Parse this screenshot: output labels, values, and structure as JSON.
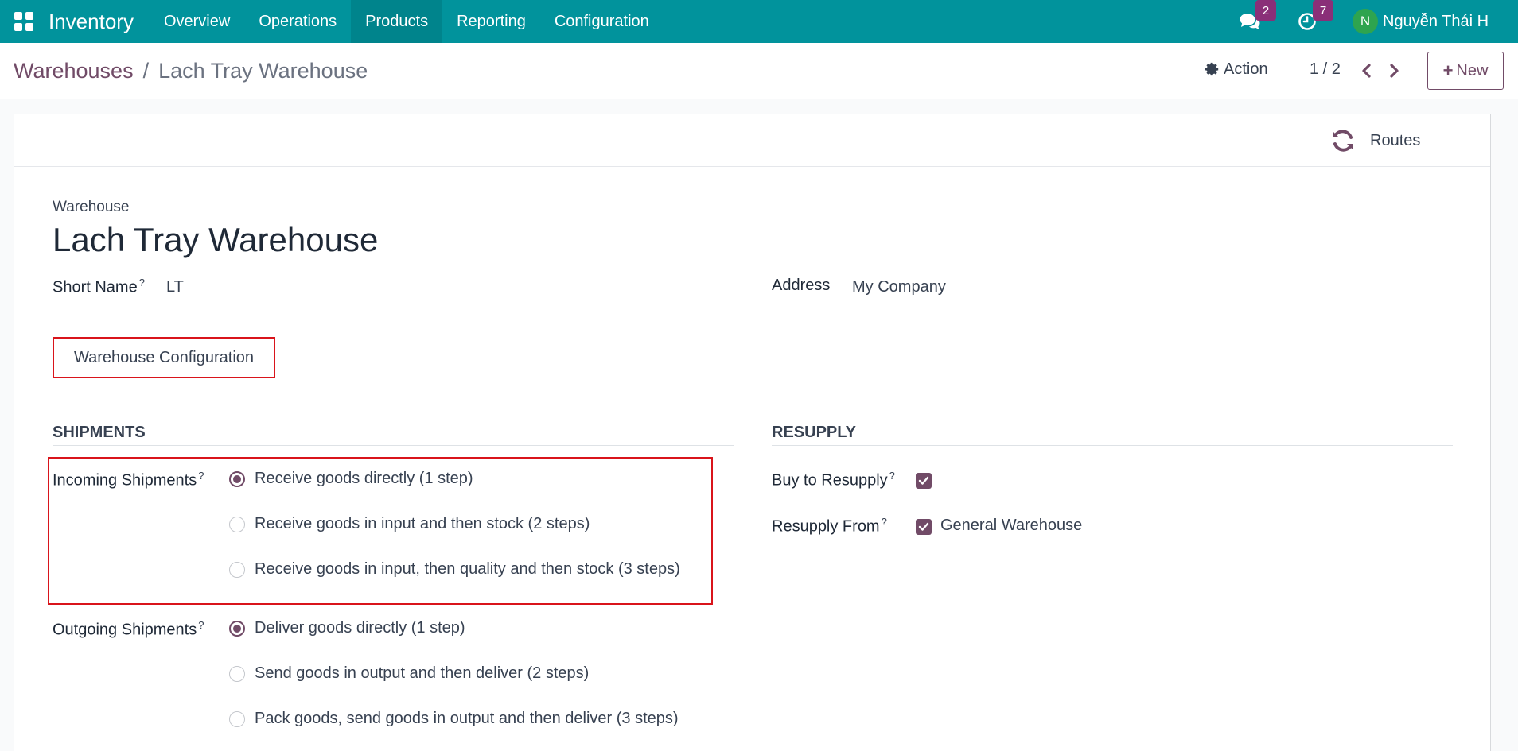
{
  "navbar": {
    "app_name": "Inventory",
    "menu": [
      "Overview",
      "Operations",
      "Products",
      "Reporting",
      "Configuration"
    ],
    "active_menu": "Products",
    "messages_count": "2",
    "activities_count": "7",
    "user_initial": "N",
    "user_name": "Nguyễn Thái H",
    "bg_color": "#01939c"
  },
  "control_panel": {
    "breadcrumb_parent": "Warehouses",
    "breadcrumb_separator": "/",
    "breadcrumb_current": "Lach Tray Warehouse",
    "action_label": "Action",
    "pager": "1 / 2",
    "new_label": "New"
  },
  "button_box": {
    "routes_label": "Routes"
  },
  "form": {
    "record_type_label": "Warehouse",
    "title": "Lach Tray Warehouse",
    "short_name_label": "Short Name",
    "short_name_value": "LT",
    "address_label": "Address",
    "address_value": "My Company",
    "help_mark": "?"
  },
  "tabs": {
    "config_tab": "Warehouse Configuration"
  },
  "shipments": {
    "section_title": "SHIPMENTS",
    "incoming_label": "Incoming Shipments",
    "incoming_options": [
      {
        "label": "Receive goods directly (1 step)",
        "checked": true
      },
      {
        "label": "Receive goods in input and then stock (2 steps)",
        "checked": false
      },
      {
        "label": "Receive goods in input, then quality and then stock (3 steps)",
        "checked": false
      }
    ],
    "outgoing_label": "Outgoing Shipments",
    "outgoing_options": [
      {
        "label": "Deliver goods directly (1 step)",
        "checked": true
      },
      {
        "label": "Send goods in output and then deliver (2 steps)",
        "checked": false
      },
      {
        "label": "Pack goods, send goods in output and then deliver (3 steps)",
        "checked": false
      }
    ]
  },
  "resupply": {
    "section_title": "RESUPPLY",
    "buy_label": "Buy to Resupply",
    "buy_checked": true,
    "resupply_from_label": "Resupply From",
    "resupply_from_value": "General Warehouse",
    "resupply_from_checked": true
  },
  "colors": {
    "brand": "#714b67",
    "highlight": "#d9141b"
  }
}
